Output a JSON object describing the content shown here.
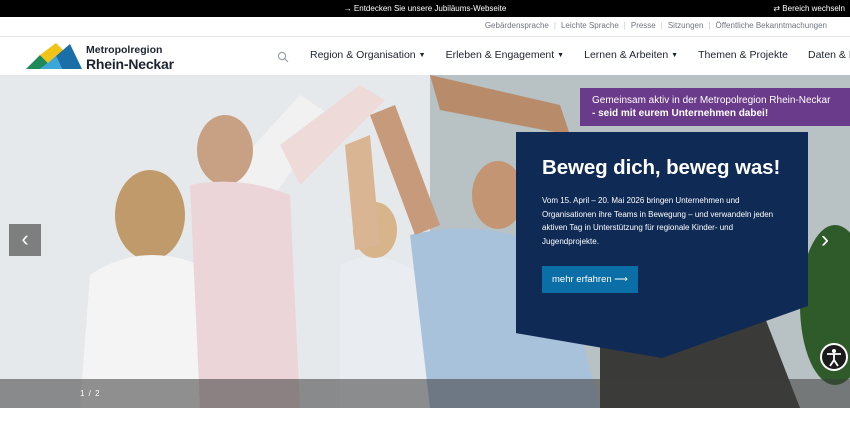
{
  "topbar": {
    "announcement": "→ Entdecken Sie unsere Jubiläums-Webseite",
    "switch_area": "⇄ Bereich wechseln"
  },
  "metanav": [
    "Gebärdensprache",
    "Leichte Sprache",
    "Presse",
    "Sitzungen",
    "Öffentliche Bekanntmachungen"
  ],
  "logo": {
    "line1": "Metropolregion",
    "line2": "Rhein-Neckar"
  },
  "search": {
    "icon": "search-icon"
  },
  "mainnav": [
    {
      "label": "Region & Organisation",
      "dropdown": true
    },
    {
      "label": "Erleben & Engagement",
      "dropdown": true
    },
    {
      "label": "Lernen & Arbeiten",
      "dropdown": true
    },
    {
      "label": "Themen & Projekte",
      "dropdown": false
    },
    {
      "label": "Daten & Fakten",
      "dropdown": true
    }
  ],
  "hero": {
    "banner_line1": "Gemeinsam aktiv in der Metropolregion Rhein-Neckar",
    "banner_line2": "- seid mit eurem Unternehmen dabei!",
    "headline": "Beweg dich, beweg was!",
    "text": "Vom 15. April – 20. Mai 2026 bringen Unternehmen und Organisationen ihre Teams in Bewegung – und verwandeln jeden aktiven Tag in Unterstützung für regionale Kinder- und Jugendprojekte.",
    "button": "mehr erfahren  ⟶",
    "counter": "1 / 2",
    "prev_icon": "chevron-left-icon",
    "next_icon": "chevron-right-icon"
  },
  "colors": {
    "accent_blue": "#0b6ea6",
    "card_navy": "#0e2a55",
    "banner_purple": "#6a3b8a"
  }
}
